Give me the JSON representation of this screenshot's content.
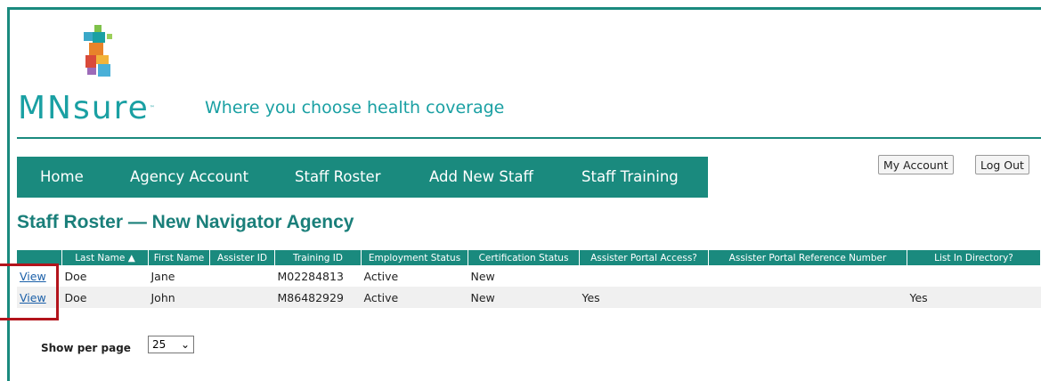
{
  "brand": {
    "logo_text": "MNsure",
    "tagline": "Where you choose health coverage",
    "colors": {
      "teal": "#1a8a7e",
      "logo_teal": "#1aa0a3",
      "title": "#1a7f7a",
      "link": "#1a5fa8",
      "highlight": "#b3141c"
    }
  },
  "nav": {
    "items": [
      "Home",
      "Agency Account",
      "Staff Roster",
      "Add New Staff",
      "Staff Training"
    ]
  },
  "account": {
    "my_account": "My Account",
    "log_out": "Log Out"
  },
  "page": {
    "title": "Staff Roster — New Navigator Agency"
  },
  "table": {
    "columns": [
      "",
      "Last Name ▲",
      "First Name",
      "Assister ID",
      "Training ID",
      "Employment Status",
      "Certification Status",
      "Assister Portal Access?",
      "Assister Portal Reference Number",
      "List In Directory?"
    ],
    "rows": [
      {
        "action": "View",
        "last": "Doe",
        "first": "Jane",
        "assister_id": "",
        "training_id": "M02284813",
        "employment": "Active",
        "certification": "New",
        "portal_access": "",
        "portal_ref": "",
        "directory": ""
      },
      {
        "action": "View",
        "last": "Doe",
        "first": "John",
        "assister_id": "",
        "training_id": "M86482929",
        "employment": "Active",
        "certification": "New",
        "portal_access": "Yes",
        "portal_ref": "",
        "directory": "Yes"
      }
    ]
  },
  "pagination": {
    "label": "Show per page",
    "selected": "25"
  }
}
